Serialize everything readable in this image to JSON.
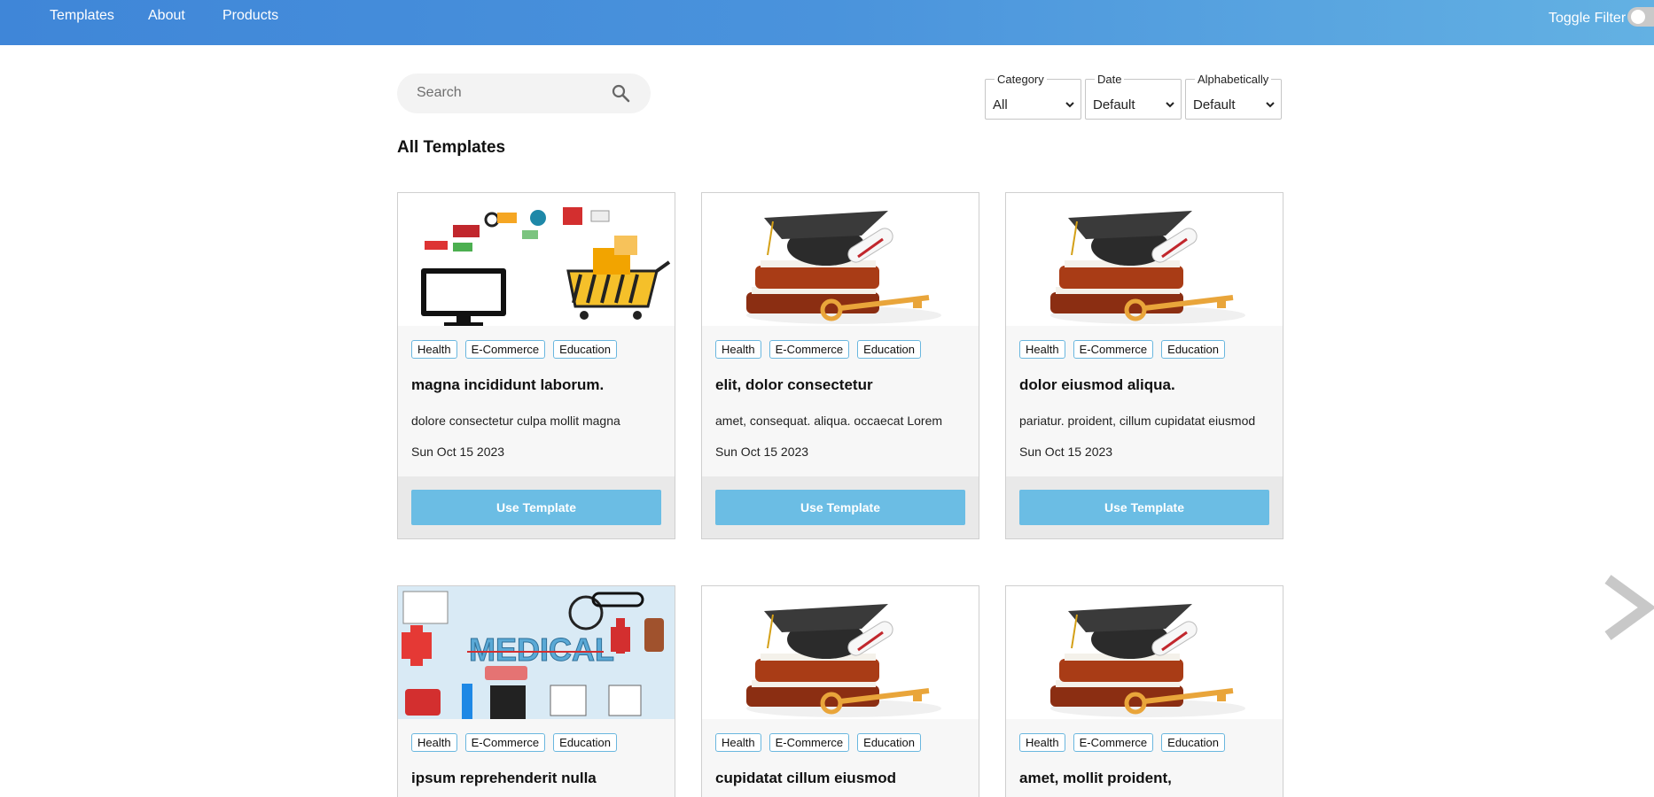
{
  "nav": {
    "links": [
      "Templates",
      "About",
      "Products"
    ],
    "toggle_label": "Toggle Filter"
  },
  "search": {
    "placeholder": "Search",
    "icon": "search-icon"
  },
  "filters": [
    {
      "legend": "Category",
      "selected": "All"
    },
    {
      "legend": "Date",
      "selected": "Default"
    },
    {
      "legend": "Alphabetically",
      "selected": "Default"
    }
  ],
  "section_title": "All Templates",
  "cards": [
    {
      "image": "ecommerce-image",
      "tags": [
        "Health",
        "E-Commerce",
        "Education"
      ],
      "title": "magna incididunt laborum.",
      "desc": "dolore consectetur culpa mollit magna",
      "date": "Sun Oct 15 2023",
      "button": "Use Template"
    },
    {
      "image": "graduation-image",
      "tags": [
        "Health",
        "E-Commerce",
        "Education"
      ],
      "title": "elit, dolor consectetur",
      "desc": "amet, consequat. aliqua. occaecat Lorem",
      "date": "Sun Oct 15 2023",
      "button": "Use Template"
    },
    {
      "image": "graduation-image",
      "tags": [
        "Health",
        "E-Commerce",
        "Education"
      ],
      "title": "dolor eiusmod aliqua.",
      "desc": "pariatur. proident, cillum cupidatat eiusmod",
      "date": "Sun Oct 15 2023",
      "button": "Use Template"
    },
    {
      "image": "medical-image",
      "image_text": "MEDICAL",
      "tags": [
        "Health",
        "E-Commerce",
        "Education"
      ],
      "title": "ipsum reprehenderit nulla"
    },
    {
      "image": "graduation-image",
      "tags": [
        "Health",
        "E-Commerce",
        "Education"
      ],
      "title": "cupidatat cillum eiusmod"
    },
    {
      "image": "graduation-image",
      "tags": [
        "Health",
        "E-Commerce",
        "Education"
      ],
      "title": "amet, mollit proident,"
    }
  ],
  "colors": {
    "nav_gradient_start": "#3f86d8",
    "nav_gradient_end": "#63b1e3",
    "tag_border": "#6ab7df",
    "button_bg": "#6bbde4",
    "arrow": "#c8c8c8"
  }
}
